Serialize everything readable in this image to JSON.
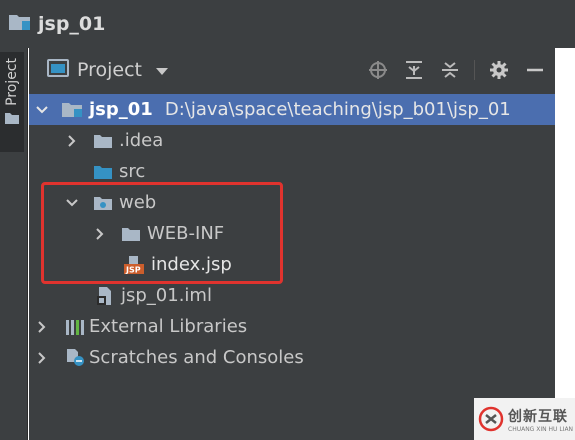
{
  "window": {
    "title": "jsp_01"
  },
  "side_tab": {
    "label": "Project"
  },
  "toolbar": {
    "view_label": "Project",
    "tools": [
      "locate-icon",
      "collapse-all-icon",
      "expand-all-icon",
      "settings-gear-icon",
      "hide-icon"
    ]
  },
  "tree": {
    "root": {
      "name": "jsp_01",
      "path": "D:\\java\\space\\teaching\\jsp_b01\\jsp_01"
    },
    "idea": "idea",
    "idea_dot": ".",
    "src": "src",
    "web": "web",
    "web_inf": "WEB-INF",
    "index_jsp": "index.jsp",
    "iml": "jsp_01.iml",
    "external_libraries": "External Libraries",
    "scratches": "Scratches and Consoles"
  },
  "watermark": {
    "text": "创新互联",
    "subtext": "CHUANG XIN HU LIAN",
    "color": "#e0332e"
  },
  "colors": {
    "selection": "#4b6eaf",
    "highlight_box": "#e0332e",
    "panel_bg": "#3c3f41"
  }
}
